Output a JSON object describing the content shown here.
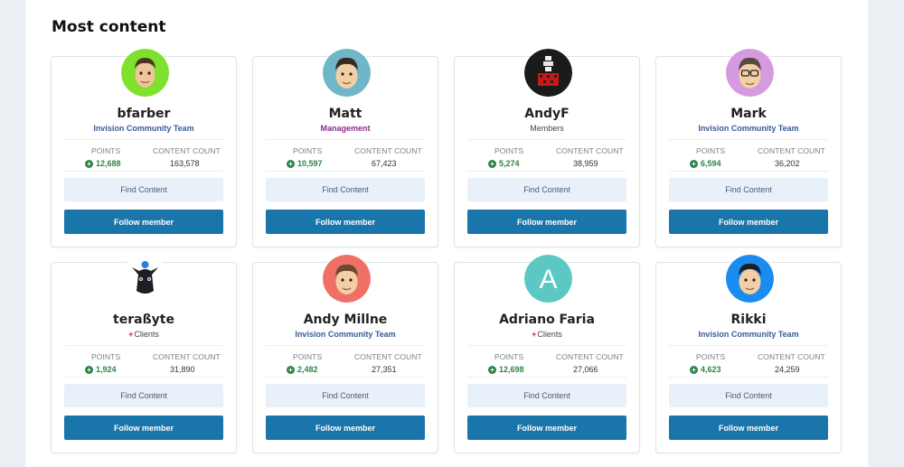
{
  "section": {
    "title": "Most content"
  },
  "labels": {
    "points": "POINTS",
    "content_count": "CONTENT COUNT",
    "find_content": "Find Content",
    "follow_member": "Follow member"
  },
  "members": [
    {
      "name": "bfarber",
      "group": "Invision Community Team",
      "points": "12,688",
      "content_count": "163,578",
      "avatar_icon": "cartoon-face-avatar",
      "avatar_color": "#7fe02d"
    },
    {
      "name": "Matt",
      "group": "Management",
      "points": "10,597",
      "content_count": "67,423",
      "avatar_icon": "cartoon-face-avatar",
      "avatar_color": "#6fb6c9"
    },
    {
      "name": "AndyF",
      "group": "Members",
      "points": "5,274",
      "content_count": "38,959",
      "avatar_icon": "pixel-art-avatar",
      "avatar_color": "#1b1b1b"
    },
    {
      "name": "Mark",
      "group": "Invision Community Team",
      "points": "6,594",
      "content_count": "36,202",
      "avatar_icon": "cartoon-face-glasses-avatar",
      "avatar_color": "#d69ae0"
    },
    {
      "name": "teraßyte",
      "group": "Clients",
      "points": "1,924",
      "content_count": "31,890",
      "avatar_icon": "dark-creature-avatar",
      "avatar_color": "#ffffff"
    },
    {
      "name": "Andy Millne",
      "group": "Invision Community Team",
      "points": "2,482",
      "content_count": "27,351",
      "avatar_icon": "cartoon-face-avatar",
      "avatar_color": "#f07067"
    },
    {
      "name": "Adriano Faria",
      "group": "Clients",
      "points": "12,698",
      "content_count": "27,066",
      "avatar_icon": "letter-avatar",
      "avatar_letter": "A",
      "avatar_color": "#5bc8c4"
    },
    {
      "name": "Rikki",
      "group": "Invision Community Team",
      "points": "4,623",
      "content_count": "24,259",
      "avatar_icon": "cartoon-face-avatar",
      "avatar_color": "#1a8cf0"
    }
  ]
}
